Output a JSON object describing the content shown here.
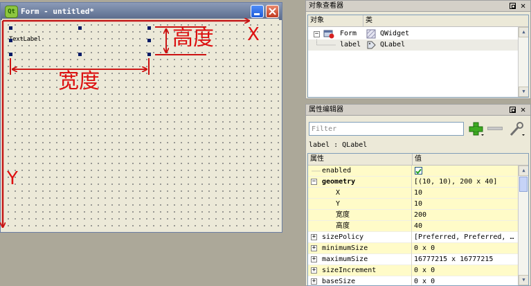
{
  "form_window": {
    "title": "Form - untitled*",
    "logo_text": "Qt",
    "text_label": "TextLabel"
  },
  "annotations": {
    "height_label": "高度",
    "width_label": "宽度",
    "x_axis": "X",
    "y_axis": "Y",
    "color": "#dd1010"
  },
  "object_inspector": {
    "title": "对象查看器",
    "columns": [
      "对象",
      "类"
    ],
    "rows": [
      {
        "object": "Form",
        "class": "QWidget"
      },
      {
        "object": "label",
        "class": "QLabel"
      }
    ]
  },
  "property_editor": {
    "title": "属性编辑器",
    "filter_placeholder": "Filter",
    "object_class": "label : QLabel",
    "columns": [
      "属性",
      "值"
    ],
    "rows": [
      {
        "name": "enabled",
        "value": "",
        "checked": true
      },
      {
        "name": "geometry",
        "value": "[(10, 10), 200 x 40]"
      },
      {
        "name": "X",
        "value": "10"
      },
      {
        "name": "Y",
        "value": "10"
      },
      {
        "name": "宽度",
        "value": "200"
      },
      {
        "name": "高度",
        "value": "40"
      },
      {
        "name": "sizePolicy",
        "value": "[Preferred, Preferred, …"
      },
      {
        "name": "minimumSize",
        "value": "0 x 0"
      },
      {
        "name": "maximumSize",
        "value": "16777215 x 16777215"
      },
      {
        "name": "sizeIncrement",
        "value": "0 x 0"
      },
      {
        "name": "baseSize",
        "value": "0 x 0"
      }
    ]
  },
  "icons": {
    "float": "float-icon",
    "close": "close-icon",
    "add": "plus-icon",
    "remove": "minus-icon",
    "configure": "wrench-icon"
  }
}
